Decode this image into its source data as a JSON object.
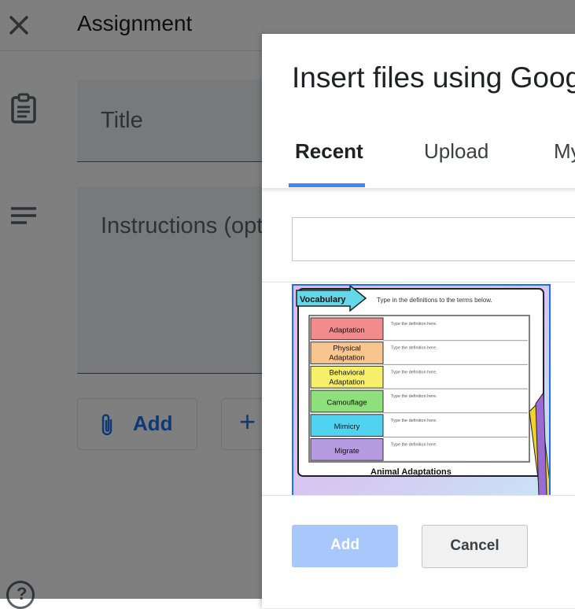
{
  "header": {
    "title": "Assignment"
  },
  "form": {
    "title_placeholder": "Title",
    "instructions_placeholder": "Instructions (optional)",
    "add_label": "Add",
    "create_label": "+"
  },
  "dialog": {
    "title": "Insert files using Google Drive",
    "tabs": [
      {
        "label": "Recent",
        "active": true
      },
      {
        "label": "Upload",
        "active": false
      },
      {
        "label": "My Drive",
        "active": false
      }
    ],
    "search_value": "",
    "file": {
      "heading": "Vocabulary",
      "instruction": "Type in the definitions to the terms below.",
      "rows": [
        {
          "term": "Adaptation",
          "definition": "Type the definition here.",
          "color": "#f28b8b"
        },
        {
          "term": "Physical Adaptation",
          "definition": "Type the definition here.",
          "color": "#f9c58f"
        },
        {
          "term": "Behavioral Adaptation",
          "definition": "Type the definition here.",
          "color": "#f6ef6a"
        },
        {
          "term": "Camouflage",
          "definition": "Type the definition here.",
          "color": "#8ee07c"
        },
        {
          "term": "Mimicry",
          "definition": "Type the definition here.",
          "color": "#4fd3f0"
        },
        {
          "term": "Migrate",
          "definition": "Type the definition here.",
          "color": "#b59be0"
        }
      ],
      "footer": "Animal Adaptations"
    },
    "add_label": "Add",
    "cancel_label": "Cancel"
  },
  "colors": {
    "accent": "#1a73e8",
    "tab_indicator": "#4285f4",
    "add_disabled": "#a8c7fa"
  }
}
